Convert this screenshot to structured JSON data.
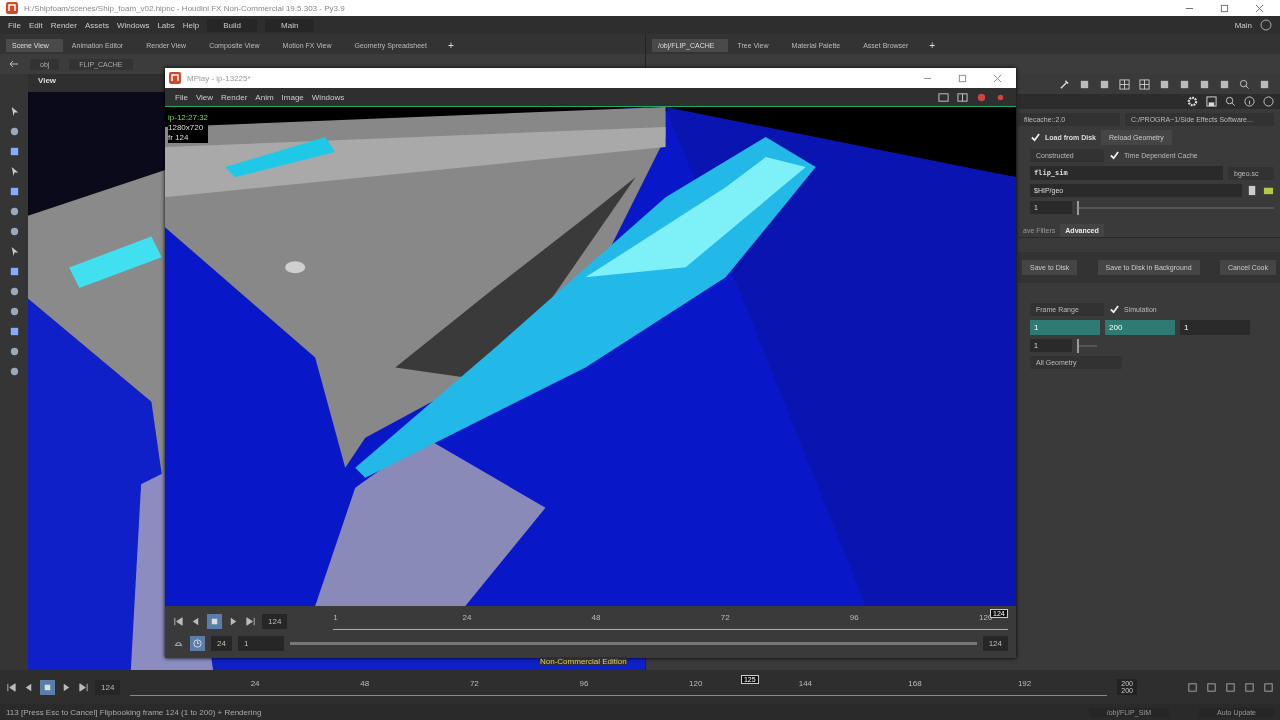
{
  "title_bar": {
    "title": "H:/Shipfoam/scenes/Ship_foam_v02.hipnc - Houdini FX Non-Commercial 19.5.303 - Py3.9"
  },
  "menu": [
    "File",
    "Edit",
    "Render",
    "Assets",
    "Windows",
    "Labs",
    "Help"
  ],
  "desktops": [
    {
      "label": "Build"
    },
    {
      "label": "Main"
    }
  ],
  "desk_corner": "Main",
  "left_tabs": [
    {
      "label": "Scene View",
      "selected": true
    },
    {
      "label": "Animation Editor",
      "selected": false
    },
    {
      "label": "Render View",
      "selected": false
    },
    {
      "label": "Composite View",
      "selected": false
    },
    {
      "label": "Motion FX View",
      "selected": false
    },
    {
      "label": "Geometry Spreadsheet",
      "selected": false
    }
  ],
  "right_tabs": [
    {
      "label": "/obj/FLIP_CACHE",
      "selected": true
    },
    {
      "label": "Tree View",
      "selected": false
    },
    {
      "label": "Material Palette",
      "selected": false
    },
    {
      "label": "Asset Browser",
      "selected": false
    }
  ],
  "add_tab": "+",
  "path": [
    "obj",
    "FLIP_CACHE"
  ],
  "viewport": {
    "label": "View"
  },
  "params": {
    "type": "filecache::2.0",
    "file_path": "C:/PROGRA~1/Side Effects Software...",
    "load_from_disk": {
      "label": "Load from Disk",
      "checked": true
    },
    "reload": "Reload Geometry",
    "mode": "Constructed",
    "time_dependent": {
      "label": "Time Dependent Cache",
      "checked": true
    },
    "base_name": "flip_sim",
    "format": "bgeo.sc",
    "base_folder": "$HIP/geo",
    "version": {
      "value": "1",
      "level": 0.0
    },
    "tabs": [
      {
        "label": "ave Filters",
        "selected": false
      },
      {
        "label": "Advanced",
        "selected": true
      }
    ],
    "buttons": [
      "Save to Disk",
      "Save to Disk in Background",
      "Cancel Cook"
    ],
    "evaluate": "Frame Range",
    "simulation": {
      "label": "Simulation",
      "checked": true
    },
    "range": [
      {
        "value": "1",
        "highlighted": true
      },
      {
        "value": "200",
        "highlighted": true
      },
      {
        "value": "1",
        "highlighted": false
      }
    ],
    "substeps": {
      "value": "1",
      "level": 0.0
    },
    "geometry": "All Geometry"
  },
  "mplay": {
    "title": "MPlay - ip-13225*",
    "menu": [
      "File",
      "View",
      "Render",
      "Anim",
      "Image",
      "Windows"
    ],
    "overlay": [
      "ip-12:27:32",
      "1280x720",
      "fr 124"
    ],
    "frame": "124",
    "ticks": [
      "1",
      "24",
      "48",
      "72",
      "96",
      "120"
    ],
    "marker": "124",
    "fps": "24",
    "start": "1",
    "end": "124",
    "level": 1.0,
    "notice": "Non-Commercial Edition"
  },
  "timeline": {
    "frame": "124",
    "ticks": [
      "24",
      "48",
      "72",
      "96",
      "120",
      "144",
      "168",
      "192"
    ],
    "marker": "125",
    "level": 0.625,
    "end": [
      "200",
      "200"
    ]
  },
  "status": {
    "message": "113 [Press Esc to Cancel] Flipbooking frame 124 (1 to 200) + Rendering",
    "node": "/obj/FLIP_SIM",
    "update": "Auto Update"
  }
}
